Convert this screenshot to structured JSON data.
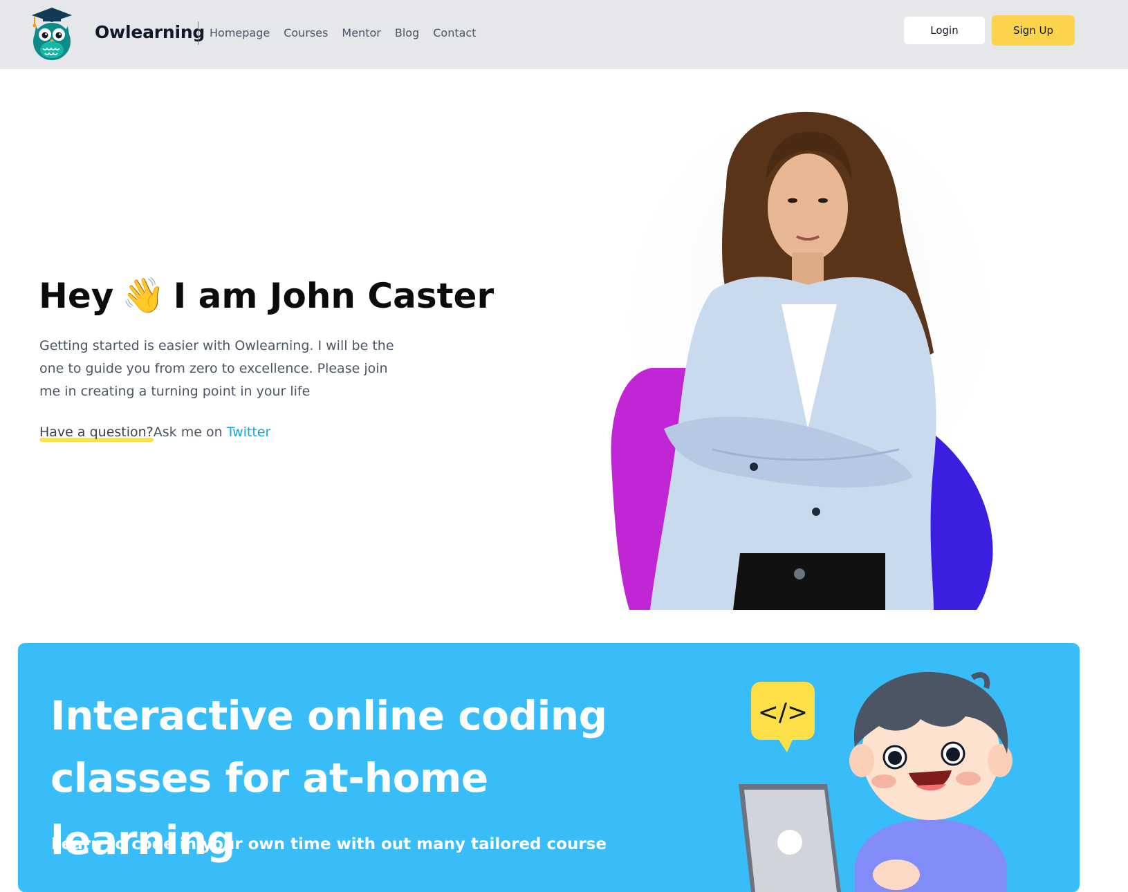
{
  "header": {
    "brand": "Owlearning",
    "nav": [
      "Homepage",
      "Courses",
      "Mentor",
      "Blog",
      "Contact"
    ],
    "login_label": "Login",
    "signup_label": "Sign Up"
  },
  "hero": {
    "title_part1": "Hey",
    "emoji": "👋",
    "title_part2": "I am John Caster",
    "description": "Getting started is easier with Owlearning. I will be the one to guide you from zero to excellence. Please join me in creating a turning point in your life",
    "question": "Have a question?",
    "ask_text": "Ask me on ",
    "twitter_label": "Twitter"
  },
  "banner": {
    "title": "Interactive online coding classes for at-home learning",
    "subtitle": "Learn to code in your own time with out many tailored course",
    "code_bubble": "</>"
  },
  "colors": {
    "header_bg": "#e5e7eb",
    "accent_yellow": "#fcd34d",
    "banner_blue": "#38bdf8",
    "link_blue": "#0ea5e9",
    "blob_purple": "#c026d3",
    "blob_blue": "#3b1fe0"
  },
  "icons": [
    "owl-logo-icon",
    "waving-hand-icon",
    "code-bubble-icon"
  ]
}
